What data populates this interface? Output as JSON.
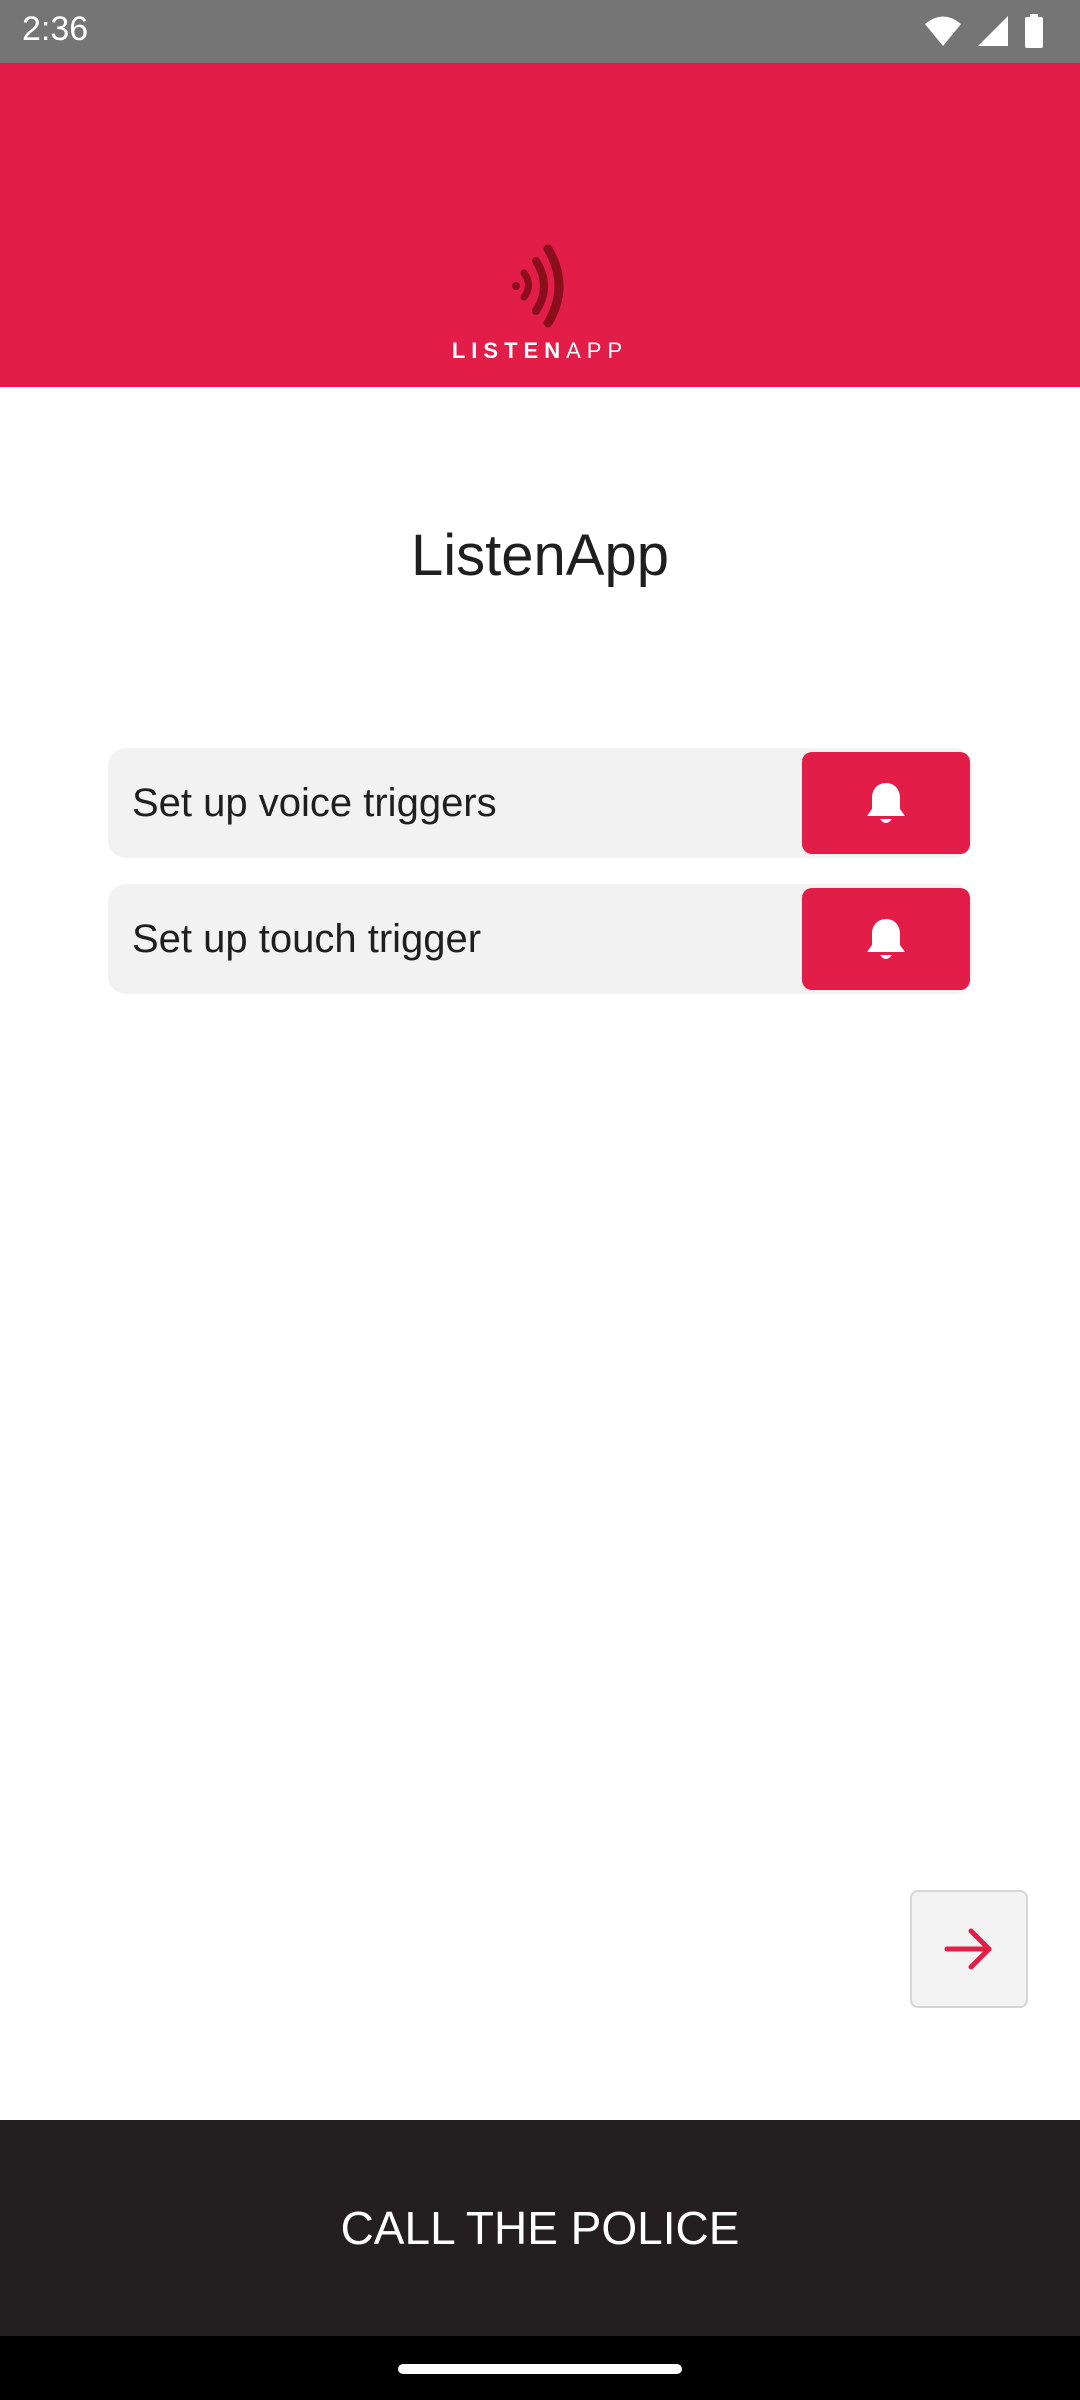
{
  "status_bar": {
    "time": "2:36",
    "icons": [
      "wifi-icon",
      "signal-icon",
      "battery-icon"
    ]
  },
  "header": {
    "logo_text_bold": "LISTEN",
    "logo_text_light": "APP",
    "background": "#e11d48"
  },
  "page": {
    "title": "ListenApp"
  },
  "triggers": [
    {
      "label": "Set up voice triggers",
      "icon": "bell-icon"
    },
    {
      "label": "Set up touch trigger",
      "icon": "bell-icon"
    }
  ],
  "navigation": {
    "next_icon": "arrow-right-icon"
  },
  "police": {
    "label": "CALL THE POLICE",
    "background": "#231f20"
  },
  "colors": {
    "accent": "#e11d48",
    "dark": "#231f20"
  }
}
